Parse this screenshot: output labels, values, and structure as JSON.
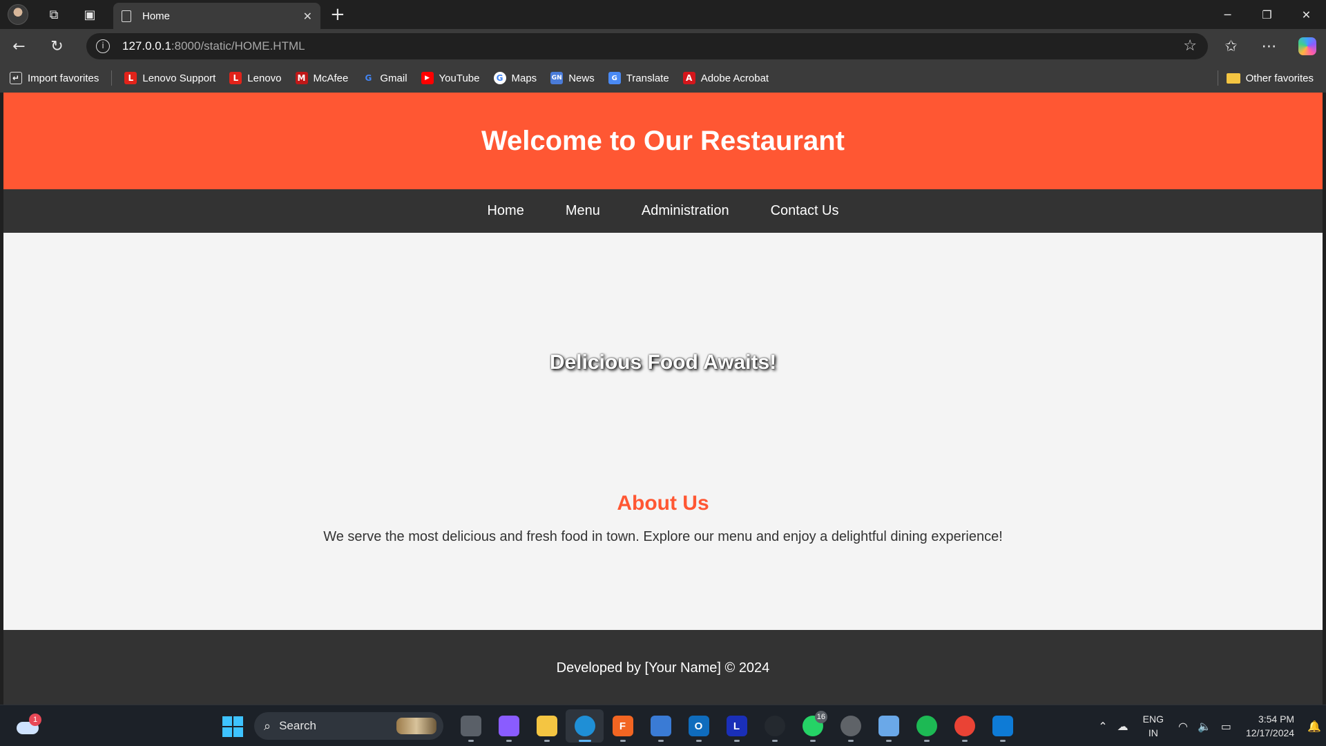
{
  "browser": {
    "tab_title": "Home",
    "url_host": "127.0.0.1",
    "url_rest": ":8000/static/HOME.HTML",
    "bookmarks": [
      {
        "label": "Import favorites",
        "icon": "import-icon",
        "color": "#3b3b3b"
      },
      {
        "label": "Lenovo Support",
        "icon": "lenovo-icon",
        "color": "#e2231a"
      },
      {
        "label": "Lenovo",
        "icon": "lenovo-icon",
        "color": "#e2231a"
      },
      {
        "label": "McAfee",
        "icon": "mcafee-icon",
        "color": "#c01818"
      },
      {
        "label": "Gmail",
        "icon": "google-icon",
        "color": "#ffffff"
      },
      {
        "label": "YouTube",
        "icon": "youtube-icon",
        "color": "#ff0000"
      },
      {
        "label": "Maps",
        "icon": "google-icon",
        "color": "#ffffff"
      },
      {
        "label": "News",
        "icon": "news-icon",
        "color": "#4a7bd8"
      },
      {
        "label": "Translate",
        "icon": "translate-icon",
        "color": "#4a8af4"
      },
      {
        "label": "Adobe Acrobat",
        "icon": "acrobat-icon",
        "color": "#d4161b"
      }
    ],
    "other_favorites": "Other favorites"
  },
  "site": {
    "title": "Welcome to Our Restaurant",
    "nav": [
      "Home",
      "Menu",
      "Administration",
      "Contact Us"
    ],
    "hero_text": "Delicious Food Awaits!",
    "about_title": "About Us",
    "about_text": "We serve the most delicious and fresh food in town. Explore our menu and enjoy a delightful dining experience!",
    "footer_text": "Developed by [Your Name] © 2024",
    "colors": {
      "accent": "#ff5733",
      "dark": "#333333",
      "background": "#f4f4f4"
    }
  },
  "taskbar": {
    "weather_badge": "1",
    "search_label": "Search",
    "apps": [
      {
        "name": "task-view",
        "label": "",
        "color": "#5a6068",
        "badge": ""
      },
      {
        "name": "copilot",
        "label": "",
        "color": "#8a5cff",
        "badge": ""
      },
      {
        "name": "file-explorer",
        "label": "",
        "color": "#f4c542",
        "badge": ""
      },
      {
        "name": "edge",
        "label": "",
        "color": "#1f8fd6",
        "badge": ""
      },
      {
        "name": "fiverr-app",
        "label": "F",
        "color": "#f26522",
        "badge": ""
      },
      {
        "name": "store",
        "label": "",
        "color": "#3a7bd5",
        "badge": ""
      },
      {
        "name": "outlook",
        "label": "O",
        "color": "#0f6cbd",
        "badge": ""
      },
      {
        "name": "lenovo-app",
        "label": "L",
        "color": "#1a2fb8",
        "badge": ""
      },
      {
        "name": "github",
        "label": "",
        "color": "#24292f",
        "badge": ""
      },
      {
        "name": "whatsapp",
        "label": "",
        "color": "#25d366",
        "badge": "16"
      },
      {
        "name": "chatgpt",
        "label": "",
        "color": "#5f6368",
        "badge": ""
      },
      {
        "name": "globe-app",
        "label": "",
        "color": "#6aa8e8",
        "badge": ""
      },
      {
        "name": "spotify",
        "label": "",
        "color": "#1db954",
        "badge": ""
      },
      {
        "name": "chrome",
        "label": "",
        "color": "#ea4335",
        "badge": ""
      },
      {
        "name": "vscode",
        "label": "",
        "color": "#0e7bd6",
        "badge": ""
      }
    ],
    "lang_line1": "ENG",
    "lang_line2": "IN",
    "time": "3:54 PM",
    "date": "12/17/2024"
  }
}
